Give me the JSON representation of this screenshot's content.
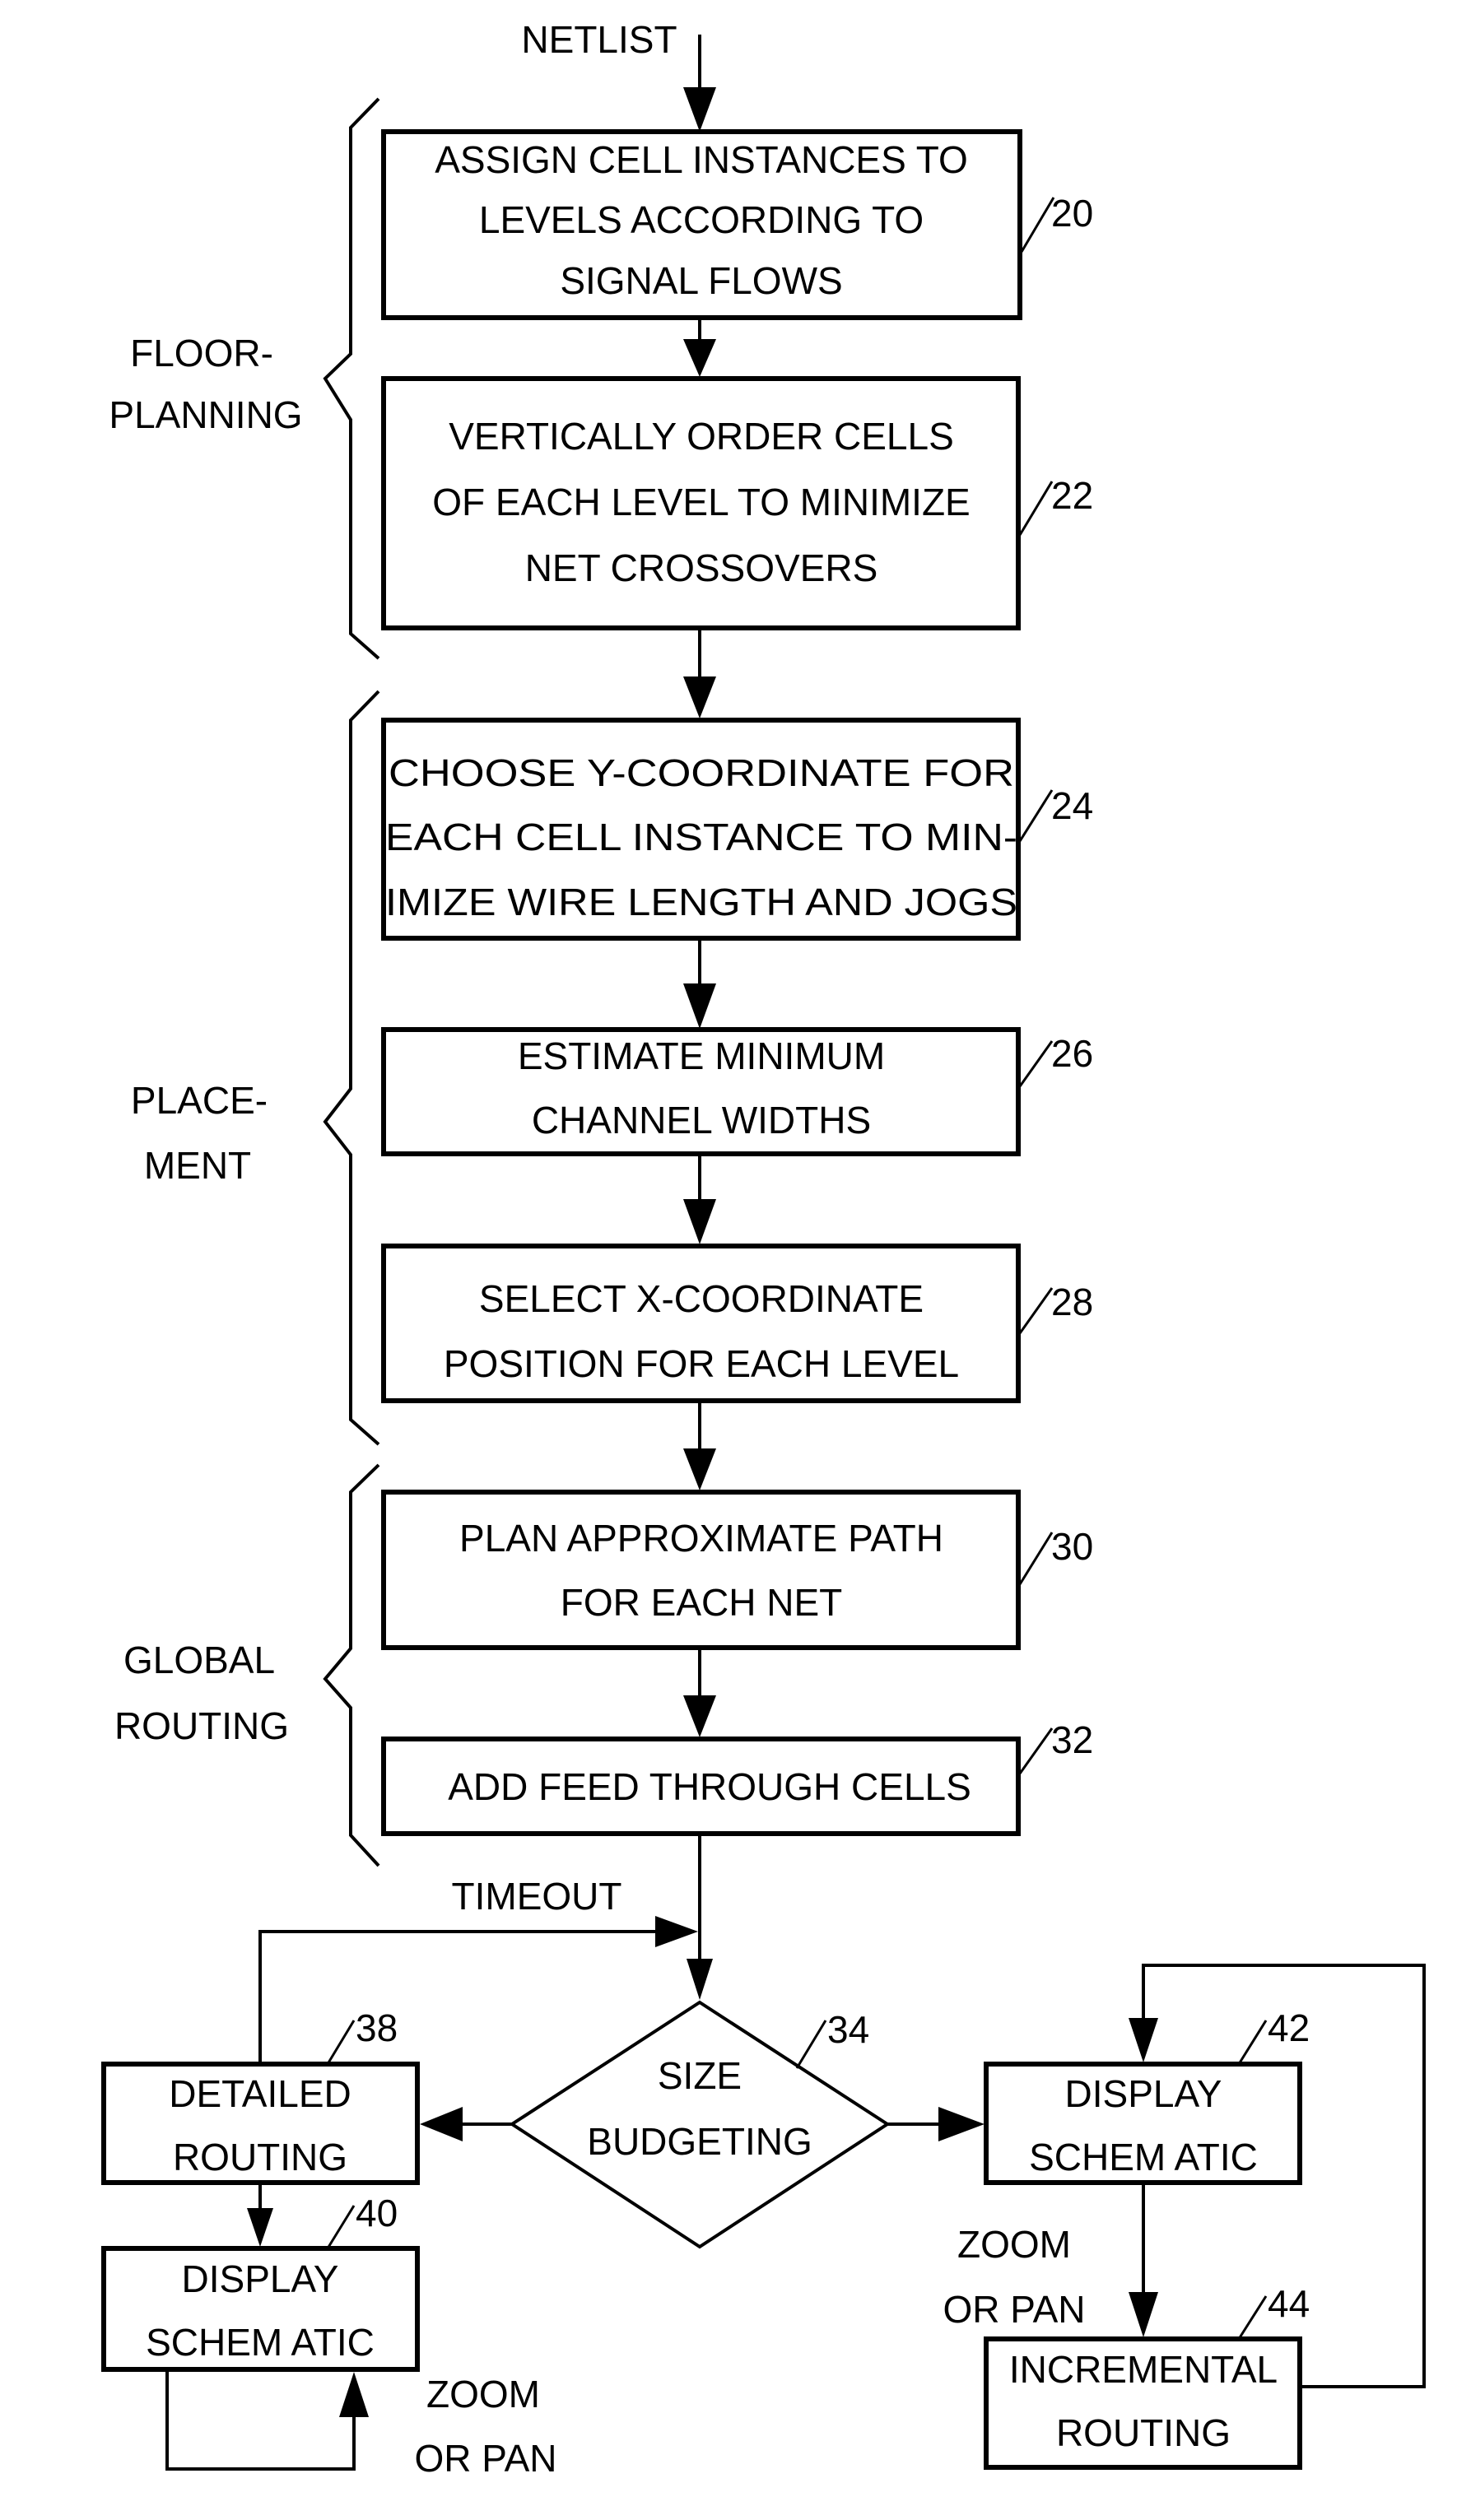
{
  "input_label": "NETLIST",
  "phases": [
    {
      "id": "floorplanning",
      "lines": [
        "FLOOR-",
        "PLANNING"
      ]
    },
    {
      "id": "placement",
      "lines": [
        "PLACE-",
        "MENT"
      ]
    },
    {
      "id": "global-routing",
      "lines": [
        "GLOBAL",
        "ROUTING"
      ]
    }
  ],
  "steps": [
    {
      "ref": "20",
      "lines": [
        "ASSIGN CELL INSTANCES TO",
        "LEVELS ACCORDING TO",
        "SIGNAL FLOWS"
      ]
    },
    {
      "ref": "22",
      "lines": [
        "VERTICALLY ORDER CELLS",
        "OF EACH LEVEL TO MINIMIZE",
        "NET CROSSOVERS"
      ]
    },
    {
      "ref": "24",
      "lines": [
        "CHOOSE Y-COORDINATE FOR",
        "EACH CELL INSTANCE TO MIN-",
        "IMIZE WIRE LENGTH AND JOGS"
      ]
    },
    {
      "ref": "26",
      "lines": [
        "ESTIMATE MINIMUM",
        "CHANNEL WIDTHS"
      ]
    },
    {
      "ref": "28",
      "lines": [
        "SELECT X-COORDINATE",
        "POSITION FOR EACH LEVEL"
      ]
    },
    {
      "ref": "30",
      "lines": [
        "PLAN APPROXIMATE PATH",
        "FOR EACH NET"
      ]
    },
    {
      "ref": "32",
      "lines": [
        "ADD FEED THROUGH CELLS"
      ]
    }
  ],
  "decision": {
    "ref": "34",
    "lines": [
      "SIZE",
      "BUDGETING"
    ]
  },
  "left_branch": [
    {
      "ref": "38",
      "lines": [
        "DETAILED",
        "ROUTING"
      ]
    },
    {
      "ref": "40",
      "lines": [
        "DISPLAY",
        "SCHEM ATIC"
      ]
    }
  ],
  "right_branch": [
    {
      "ref": "42",
      "lines": [
        "DISPLAY",
        "SCHEM ATIC"
      ]
    },
    {
      "ref": "44",
      "lines": [
        "INCREMENTAL",
        "ROUTING"
      ]
    }
  ],
  "edge_labels": {
    "timeout": "TIMEOUT",
    "zoom_pan_left": [
      "ZOOM",
      "OR PAN"
    ],
    "zoom_pan_right": [
      "ZOOM",
      "OR PAN"
    ]
  }
}
